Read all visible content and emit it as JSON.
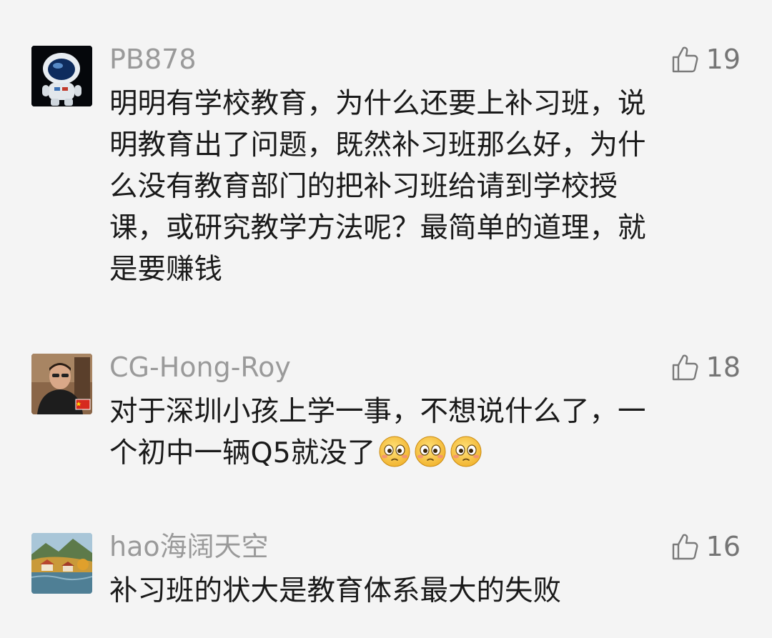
{
  "comments": [
    {
      "username": "PB878",
      "likes": "19",
      "avatar_icon": "astronaut-avatar",
      "lines": [
        "明明有学校教育，为什么还要上补习班，说",
        "明教育出了问题，既然补习班那么好，为什",
        "么没有教育部门的把补习班给请到学校授",
        "课，或研究教学方法呢？最简单的道理，就",
        "是要赚钱"
      ]
    },
    {
      "username": "CG-Hong-Roy",
      "likes": "18",
      "avatar_icon": "man-photo-avatar-with-china-flag",
      "lines": [
        "对于深圳小孩上学一事，不想说什么了，一",
        "个初中一辆Q5就没了"
      ],
      "emojis": [
        "worried-face-emoji",
        "worried-face-emoji",
        "worried-face-emoji"
      ]
    },
    {
      "username": "hao海阔天空",
      "likes": "16",
      "avatar_icon": "landscape-photo-avatar",
      "lines": [
        "补习班的状大是教育体系最大的失败"
      ]
    }
  ],
  "colors": {
    "background": "#f4f4f4",
    "username": "#9a9a9a",
    "body_text": "#1a1a1a",
    "like_count": "#757575"
  }
}
